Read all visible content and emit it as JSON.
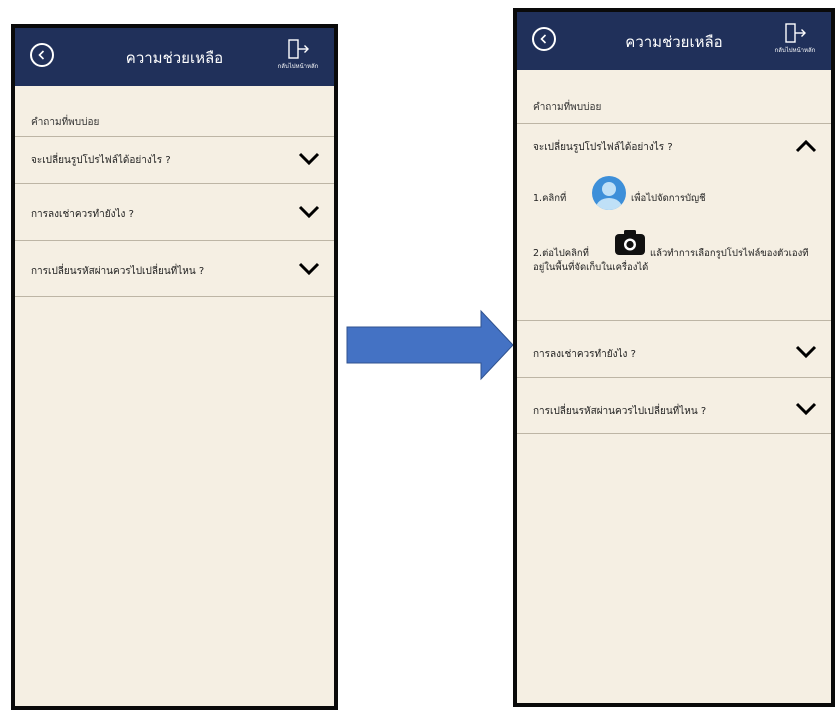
{
  "colors": {
    "header_bg": "#20305a",
    "screen_bg": "#f5efe3",
    "arrow_fill": "#4472c4",
    "avatar_blue": "#3d8fd9"
  },
  "left_screen": {
    "header": {
      "back_icon": "circle-chevron-left-icon",
      "title": "ความช่วยเหลือ",
      "home_icon": "exit-door-arrow-icon",
      "home_label": "กลับไปหน้าหลัก"
    },
    "section_title": "คำถามที่พบบ่อย",
    "faq_items": [
      {
        "question": "จะเปลี่ยนรูปโปรไฟล์ได้อย่างไร ?",
        "expanded": false
      },
      {
        "question": "การลงเช่าควรทำยังไง ?",
        "expanded": false
      },
      {
        "question": "การเปลี่ยนรหัสผ่านควรไปเปลี่ยนที่ไหน ?",
        "expanded": false
      }
    ]
  },
  "right_screen": {
    "header": {
      "back_icon": "circle-chevron-left-icon",
      "title": "ความช่วยเหลือ",
      "home_icon": "exit-door-arrow-icon",
      "home_label": "กลับไปหน้าหลัก"
    },
    "section_title": "คำถามที่พบบ่อย",
    "faq_items": [
      {
        "question": "จะเปลี่ยนรูปโปรไฟล์ได้อย่างไร ?",
        "expanded": true
      },
      {
        "question": "การลงเช่าควรทำยังไง ?",
        "expanded": false
      },
      {
        "question": "การเปลี่ยนรหัสผ่านควรไปเปลี่ยนที่ไหน ?",
        "expanded": false
      }
    ],
    "answer": {
      "step1_prefix": "1.คลิกที่",
      "step1_suffix": "เพื่อไปจัดการบัญชี",
      "step1_icon": "profile-avatar-icon",
      "step2_prefix": "2.ต่อไปคลิกที่",
      "step2_suffix": "แล้วทำการเลือกรูปโปรไฟล์ของตัวเองที",
      "step2_line2": "อยู่ในพื้นที่จัดเก็บในเครื่องได้",
      "step2_icon": "camera-icon"
    }
  }
}
